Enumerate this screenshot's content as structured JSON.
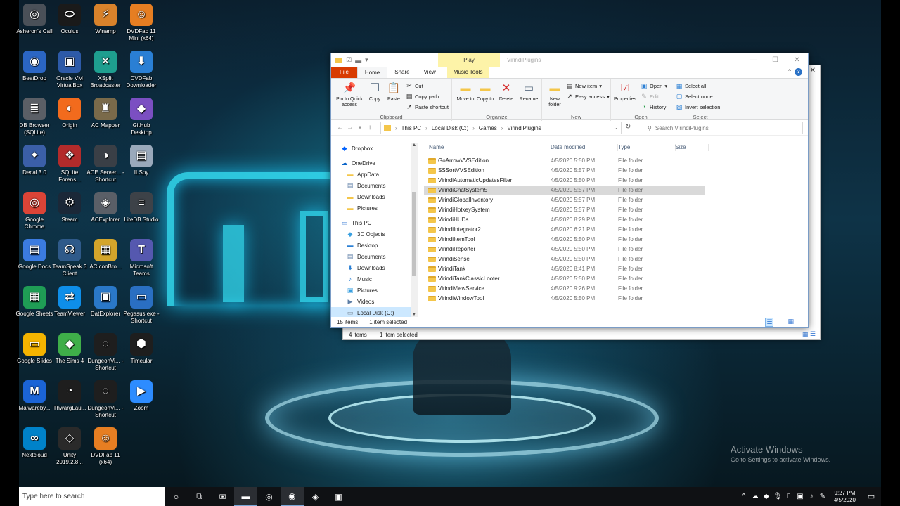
{
  "desktop": {
    "icons": [
      {
        "label": "Asheron's Call",
        "icon": "asherons-call-icon",
        "color": "#4a5058",
        "glyph": "◎"
      },
      {
        "label": "Oculus",
        "icon": "oculus-icon",
        "color": "#1a1a1a",
        "glyph": "⬭"
      },
      {
        "label": "Winamp",
        "icon": "winamp-icon",
        "color": "#d9822b",
        "glyph": "⚡"
      },
      {
        "label": "DVDFab 11 Mini (x64)",
        "icon": "dvdfab-icon",
        "color": "#e67e22",
        "glyph": "☺"
      },
      {
        "label": "BeatDrop",
        "icon": "beatdrop-icon",
        "color": "#2b66c4",
        "glyph": "◉"
      },
      {
        "label": "Oracle VM VirtualBox",
        "icon": "virtualbox-icon",
        "color": "#2d5aa8",
        "glyph": "▣"
      },
      {
        "label": "XSplit Broadcaster",
        "icon": "xsplit-icon",
        "color": "#1e9e8f",
        "glyph": "✕"
      },
      {
        "label": "DVDFab Downloader",
        "icon": "dvdfab-downloader-icon",
        "color": "#2a7fd4",
        "glyph": "⬇"
      },
      {
        "label": "DB Browser (SQLite)",
        "icon": "db-browser-icon",
        "color": "#5b5f66",
        "glyph": "≣"
      },
      {
        "label": "Origin",
        "icon": "origin-icon",
        "color": "#f26b1d",
        "glyph": "◐"
      },
      {
        "label": "AC Mapper",
        "icon": "ac-mapper-icon",
        "color": "#7a6a4a",
        "glyph": "♜"
      },
      {
        "label": "GitHub Desktop",
        "icon": "github-desktop-icon",
        "color": "#7b4fc2",
        "glyph": "◆"
      },
      {
        "label": "Decal 3.0",
        "icon": "decal-icon",
        "color": "#3b5fa8",
        "glyph": "✦"
      },
      {
        "label": "SQLite Forens...",
        "icon": "sqlite-forensic-icon",
        "color": "#b32b2b",
        "glyph": "❖"
      },
      {
        "label": "ACE.Server... - Shortcut",
        "icon": "ace-server-icon",
        "color": "#3a3f46",
        "glyph": "◑"
      },
      {
        "label": "ILSpy",
        "icon": "ilspy-icon",
        "color": "#9aa9bb",
        "glyph": "▤"
      },
      {
        "label": "Google Chrome",
        "icon": "chrome-icon",
        "color": "#db4437",
        "glyph": "◎"
      },
      {
        "label": "Steam",
        "icon": "steam-icon",
        "color": "#1b2838",
        "glyph": "⚙"
      },
      {
        "label": "ACExplorer",
        "icon": "acexplorer-icon",
        "color": "#5a5f67",
        "glyph": "◈"
      },
      {
        "label": "LiteDB.Studio",
        "icon": "litedb-icon",
        "color": "#3d4248",
        "glyph": "≡"
      },
      {
        "label": "Google Docs",
        "icon": "google-docs-icon",
        "color": "#3b7be0",
        "glyph": "▤"
      },
      {
        "label": "TeamSpeak 3 Client",
        "icon": "teamspeak-icon",
        "color": "#2f5a8a",
        "glyph": "☊"
      },
      {
        "label": "ACIconBro...",
        "icon": "aciconbrowser-icon",
        "color": "#d4a52b",
        "glyph": "▦"
      },
      {
        "label": "Microsoft Teams",
        "icon": "teams-icon",
        "color": "#5558af",
        "glyph": "T"
      },
      {
        "label": "Google Sheets",
        "icon": "google-sheets-icon",
        "color": "#1f9d55",
        "glyph": "▦"
      },
      {
        "label": "TeamViewer",
        "icon": "teamviewer-icon",
        "color": "#0e8ee9",
        "glyph": "⇄"
      },
      {
        "label": "DatExplorer",
        "icon": "datexplorer-icon",
        "color": "#2a78c8",
        "glyph": "▣"
      },
      {
        "label": "Pegasus.exe - Shortcut",
        "icon": "pegasus-icon",
        "color": "#2a6fc2",
        "glyph": "▭"
      },
      {
        "label": "Google Slides",
        "icon": "google-slides-icon",
        "color": "#f4b400",
        "glyph": "▭"
      },
      {
        "label": "The Sims 4",
        "icon": "sims4-icon",
        "color": "#3fae49",
        "glyph": "◆"
      },
      {
        "label": "DungeonVi... - Shortcut",
        "icon": "dungeonviewer-icon",
        "color": "#1e1e1e",
        "glyph": "◌"
      },
      {
        "label": "Timeular",
        "icon": "timeular-icon",
        "color": "#1e1e1e",
        "glyph": "⬢"
      },
      {
        "label": "Malwareby...",
        "icon": "malwarebytes-icon",
        "color": "#1b64d6",
        "glyph": "M"
      },
      {
        "label": "ThwargLau...",
        "icon": "thwarglauncher-icon",
        "color": "#1e1e1e",
        "glyph": "◔"
      },
      {
        "label": "DungeonVi... - Shortcut",
        "icon": "dungeonviewer2-icon",
        "color": "#1e1e1e",
        "glyph": "◌"
      },
      {
        "label": "Zoom",
        "icon": "zoom-icon",
        "color": "#2d8cff",
        "glyph": "▶"
      },
      {
        "label": "Nextcloud",
        "icon": "nextcloud-icon",
        "color": "#0082c9",
        "glyph": "∞"
      },
      {
        "label": "Unity 2019.2.8...",
        "icon": "unity-icon",
        "color": "#2a2a2a",
        "glyph": "◇"
      },
      {
        "label": "DVDFab 11 (x64)",
        "icon": "dvdfab11-icon",
        "color": "#e67e22",
        "glyph": "☺"
      }
    ],
    "activate_title": "Activate Windows",
    "activate_sub": "Go to Settings to activate Windows."
  },
  "taskbar": {
    "search_placeholder": "Type here to search",
    "time": "9:27 PM",
    "date": "4/5/2020",
    "apps": [
      {
        "name": "cortana-icon",
        "glyph": "○",
        "active": false
      },
      {
        "name": "task-view-icon",
        "glyph": "⧉",
        "active": false
      },
      {
        "name": "outlook-icon",
        "glyph": "✉",
        "active": false
      },
      {
        "name": "file-explorer-icon",
        "glyph": "▬",
        "active": true
      },
      {
        "name": "chrome-taskbar-icon",
        "glyph": "◎",
        "active": false
      },
      {
        "name": "obs-icon",
        "glyph": "◉",
        "active": true
      },
      {
        "name": "discord-icon",
        "glyph": "◈",
        "active": false
      },
      {
        "name": "xsplit-taskbar-icon",
        "glyph": "▣",
        "active": false
      }
    ],
    "tray_icons": [
      "chevron-up-icon",
      "onedrive-icon",
      "dropbox-icon",
      "microphone-icon",
      "usb-icon",
      "network-icon",
      "volume-icon",
      "pen-icon"
    ]
  },
  "bg_window": {
    "close": "✕",
    "item_count": "4 items",
    "selected": "1 item selected"
  },
  "window": {
    "title": "VirindiPlugins",
    "play_tab": "Play",
    "tabs": {
      "file": "File",
      "home": "Home",
      "share": "Share",
      "view": "View",
      "music_tools": "Music Tools"
    },
    "ribbon": {
      "clipboard": {
        "label": "Clipboard",
        "pin": "Pin to Quick access",
        "copy": "Copy",
        "paste": "Paste",
        "cut": "Cut",
        "copy_path": "Copy path",
        "paste_shortcut": "Paste shortcut"
      },
      "organize": {
        "label": "Organize",
        "move_to": "Move to",
        "copy_to": "Copy to",
        "delete": "Delete",
        "rename": "Rename"
      },
      "new": {
        "label": "New",
        "new_folder": "New folder",
        "new_item": "New item",
        "easy_access": "Easy access"
      },
      "open": {
        "label": "Open",
        "properties": "Properties",
        "open": "Open",
        "edit": "Edit",
        "history": "History"
      },
      "select": {
        "label": "Select",
        "select_all": "Select all",
        "select_none": "Select none",
        "invert": "Invert selection"
      }
    },
    "address": {
      "crumbs": [
        "This PC",
        "Local Disk (C:)",
        "Games",
        "VirindiPlugins"
      ],
      "search_placeholder": "Search VirindiPlugins"
    },
    "nav": [
      {
        "label": "Dropbox",
        "icon": "dropbox-icon",
        "glyph": "◆",
        "color": "#0061fe",
        "indent": 14
      },
      {
        "label": "OneDrive",
        "icon": "onedrive-icon",
        "glyph": "☁",
        "color": "#0a64c8",
        "indent": 14
      },
      {
        "label": "AppData",
        "icon": "folder-icon",
        "glyph": "▬",
        "color": "#f4c64a",
        "indent": 22
      },
      {
        "label": "Documents",
        "icon": "documents-icon",
        "glyph": "▤",
        "color": "#5d7ea6",
        "indent": 22
      },
      {
        "label": "Downloads",
        "icon": "folder-icon",
        "glyph": "▬",
        "color": "#f4c64a",
        "indent": 22
      },
      {
        "label": "Pictures",
        "icon": "folder-icon",
        "glyph": "▬",
        "color": "#f4c64a",
        "indent": 22
      },
      {
        "label": "This PC",
        "icon": "this-pc-icon",
        "glyph": "▭",
        "color": "#3a7bd5",
        "indent": 14
      },
      {
        "label": "3D Objects",
        "icon": "3d-objects-icon",
        "glyph": "◆",
        "color": "#3aa0e0",
        "indent": 22
      },
      {
        "label": "Desktop",
        "icon": "desktop-icon",
        "glyph": "▬",
        "color": "#2a7fd4",
        "indent": 22
      },
      {
        "label": "Documents",
        "icon": "documents-icon",
        "glyph": "▤",
        "color": "#5d7ea6",
        "indent": 22
      },
      {
        "label": "Downloads",
        "icon": "downloads-icon",
        "glyph": "⬇",
        "color": "#2a7fd4",
        "indent": 22
      },
      {
        "label": "Music",
        "icon": "music-icon",
        "glyph": "♪",
        "color": "#2a7fd4",
        "indent": 22
      },
      {
        "label": "Pictures",
        "icon": "pictures-icon",
        "glyph": "▣",
        "color": "#3aa0e0",
        "indent": 22
      },
      {
        "label": "Videos",
        "icon": "videos-icon",
        "glyph": "▶",
        "color": "#5d7ea6",
        "indent": 22
      },
      {
        "label": "Local Disk (C:)",
        "icon": "local-disk-icon",
        "glyph": "▭",
        "color": "#7a8a99",
        "indent": 22
      }
    ],
    "columns": {
      "name": "Name",
      "date": "Date modified",
      "type": "Type",
      "size": "Size"
    },
    "files": [
      {
        "name": "GoArrowVVSEdition",
        "date": "4/5/2020 5:50 PM",
        "type": "File folder"
      },
      {
        "name": "SSSortVVSEdition",
        "date": "4/5/2020 5:57 PM",
        "type": "File folder"
      },
      {
        "name": "VirindiAutomaticUpdatesFilter",
        "date": "4/5/2020 5:50 PM",
        "type": "File folder"
      },
      {
        "name": "VirindiChatSystem5",
        "date": "4/5/2020 5:57 PM",
        "type": "File folder"
      },
      {
        "name": "VirindiGlobalInventory",
        "date": "4/5/2020 5:57 PM",
        "type": "File folder"
      },
      {
        "name": "VirindiHotkeySystem",
        "date": "4/5/2020 5:57 PM",
        "type": "File folder"
      },
      {
        "name": "VirindiHUDs",
        "date": "4/5/2020 8:29 PM",
        "type": "File folder"
      },
      {
        "name": "VirindiIntegrator2",
        "date": "4/5/2020 6:21 PM",
        "type": "File folder"
      },
      {
        "name": "VirindiItemTool",
        "date": "4/5/2020 5:50 PM",
        "type": "File folder"
      },
      {
        "name": "VirindiReporter",
        "date": "4/5/2020 5:50 PM",
        "type": "File folder"
      },
      {
        "name": "VirindiSense",
        "date": "4/5/2020 5:50 PM",
        "type": "File folder"
      },
      {
        "name": "VirindiTank",
        "date": "4/5/2020 8:41 PM",
        "type": "File folder"
      },
      {
        "name": "VirindiTankClassicLooter",
        "date": "4/5/2020 5:50 PM",
        "type": "File folder"
      },
      {
        "name": "VirindiViewService",
        "date": "4/5/2020 9:26 PM",
        "type": "File folder"
      },
      {
        "name": "VirindiWindowTool",
        "date": "4/5/2020 5:50 PM",
        "type": "File folder"
      }
    ],
    "selected_index": 3,
    "status": {
      "count": "15 items",
      "selected": "1 item selected"
    }
  }
}
